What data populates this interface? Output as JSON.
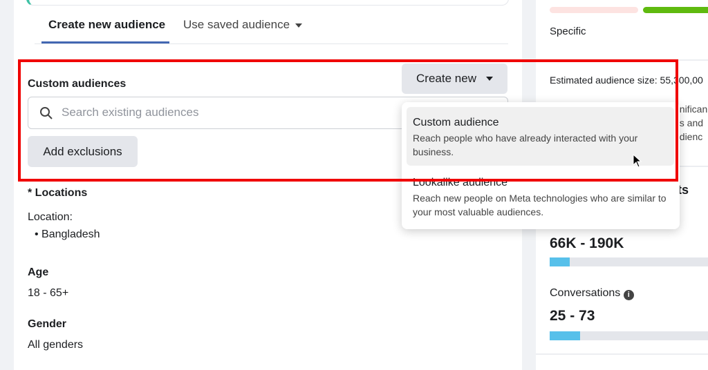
{
  "tabs": [
    {
      "label": "Create new audience",
      "active": true
    },
    {
      "label": "Use saved audience"
    }
  ],
  "custom_audiences": {
    "label": "Custom audiences",
    "create_new": "Create new",
    "search_placeholder": "Search existing audiences",
    "add_exclusions": "Add exclusions"
  },
  "dropdown": [
    {
      "title": "Custom audience",
      "desc": "Reach people who have already interacted with your business.",
      "highlighted": true
    },
    {
      "title": "Lookalike audience",
      "desc": "Reach new people on Meta technologies who are similar to your most valuable audiences."
    }
  ],
  "locations": {
    "label": "* Locations",
    "sub": "Location:",
    "items": [
      "• Bangladesh"
    ]
  },
  "age": {
    "label": "Age",
    "value": "18 - 65+"
  },
  "gender": {
    "label": "Gender",
    "value": "All genders"
  },
  "right": {
    "specific": "Specific",
    "audience_size": "Estimated audience size: 55,300,00",
    "hidden_lines": [
      "gnifican",
      "ns and",
      "udienc"
    ],
    "heading_tail": "ts",
    "reach": "66K - 190K",
    "reach_fill": 0.11,
    "conversations_label": "Conversations",
    "conversations": "25 - 73",
    "conversations_fill": 0.17
  },
  "colors": {
    "accent": "#4267b2",
    "bar": "#57c0ea",
    "green": "#5fba0f",
    "highlight": "#f00000"
  }
}
